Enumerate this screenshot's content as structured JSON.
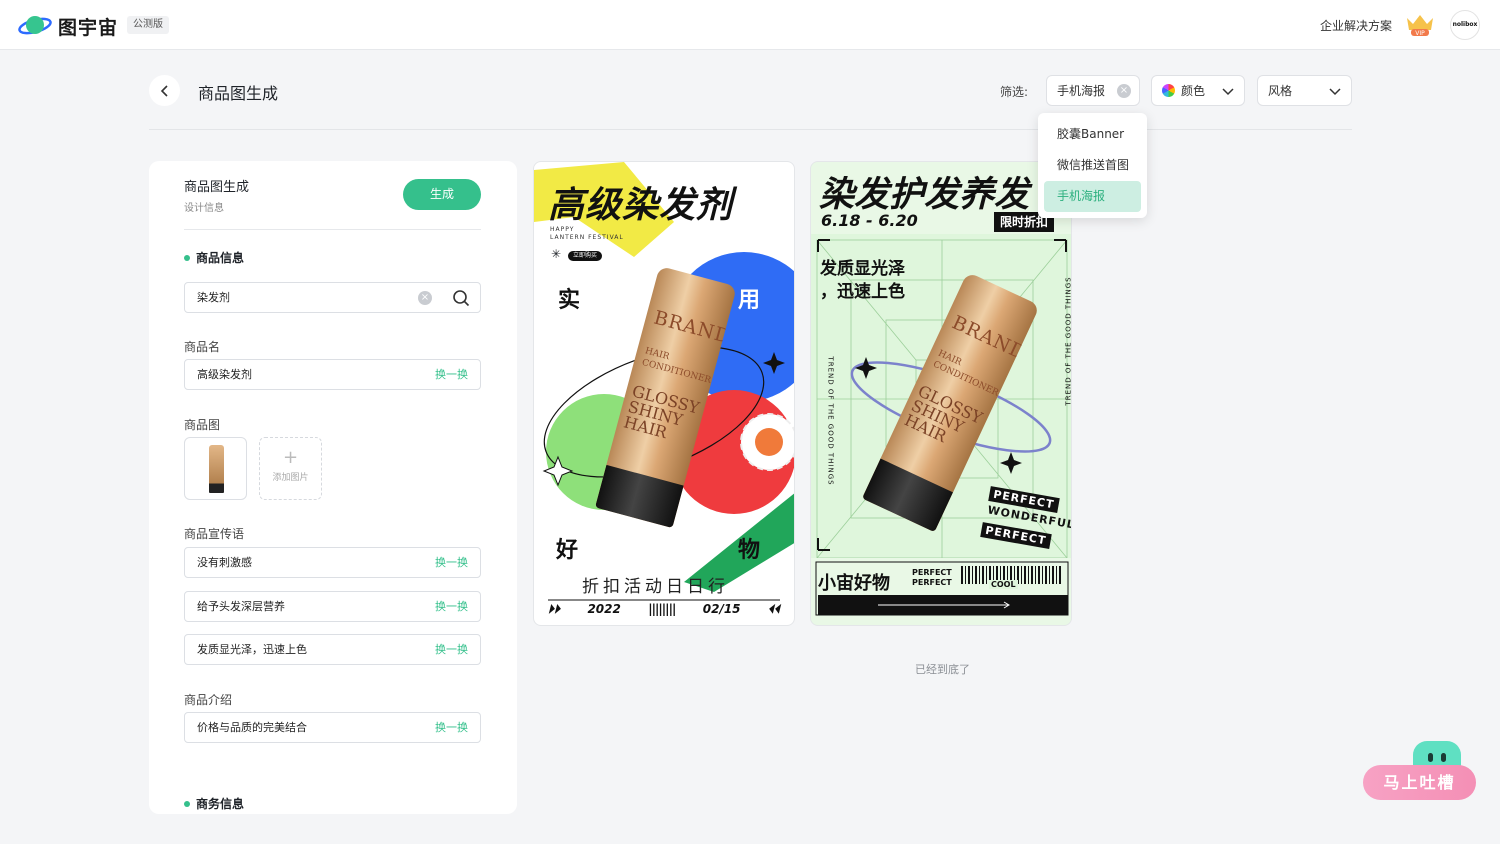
{
  "header": {
    "logo_text": "图宇宙",
    "beta_badge": "公测版",
    "enterprise_link": "企业解决方案",
    "vip_label": "VIP",
    "avatar_text": "nolibox"
  },
  "page": {
    "title": "商品图生成",
    "filter_label": "筛选:",
    "filters": {
      "type_value": "手机海报",
      "color_label": "颜色",
      "style_label": "风格"
    },
    "dropdown_items": [
      "胶囊Banner",
      "微信推送首图",
      "手机海报"
    ],
    "dropdown_selected": "手机海报",
    "end_hint": "已经到底了"
  },
  "panel": {
    "title": "商品图生成",
    "subtitle": "设计信息",
    "generate_label": "生成",
    "product_info_heading": "商品信息",
    "search_value": "染发剂",
    "name_label": "商品名",
    "name_value": "高级染发剂",
    "swap_label": "换一换",
    "image_label": "商品图",
    "add_image_label": "添加图片",
    "slogan_label": "商品宣传语",
    "slogans": [
      "没有刺激感",
      "给予头发深层营养",
      "发质显光泽，迅速上色"
    ],
    "intro_label": "商品介绍",
    "intro_value": "价格与品质的完美结合",
    "business_heading": "商务信息"
  },
  "poster1": {
    "title": "高级染发剂",
    "sub_line1": "HAPPY",
    "sub_line2": "LANTERN FESTIVAL",
    "buy_badge": "立即购买",
    "char_1": "实",
    "char_2": "用",
    "char_3": "好",
    "char_4": "物",
    "event": "折扣活动日日行",
    "year": "2022",
    "date": "02/15",
    "tube_brand": "BRAND",
    "tube_mid": "HAIR CONDITIONER",
    "tube_gloss": "GLOSSY SHINY HAIR"
  },
  "poster2": {
    "title": "染发护发养发",
    "date_range": "6.18 - 6.20",
    "limit_badge": "限时折扣",
    "copy_line1": "发质显光泽",
    "copy_line2": "，迅速上色",
    "vertical_text": "TREND OF THE GOOD THINGS",
    "tag_1": "PERFECT",
    "tag_2": "WONDERFUL",
    "tag_3": "PERFECT",
    "brand": "小宙好物",
    "perfect_1": "PERFECT",
    "perfect_2": "PERFECT",
    "cool": "COOL",
    "tube_brand": "BRAND",
    "tube_mid": "HAIR CONDITIONER",
    "tube_gloss": "GLOSSY SHINY HAIR"
  },
  "feedback": {
    "label": "马上吐槽"
  },
  "colors": {
    "accent": "#35c08c",
    "selected_bg": "#cdeee2"
  }
}
